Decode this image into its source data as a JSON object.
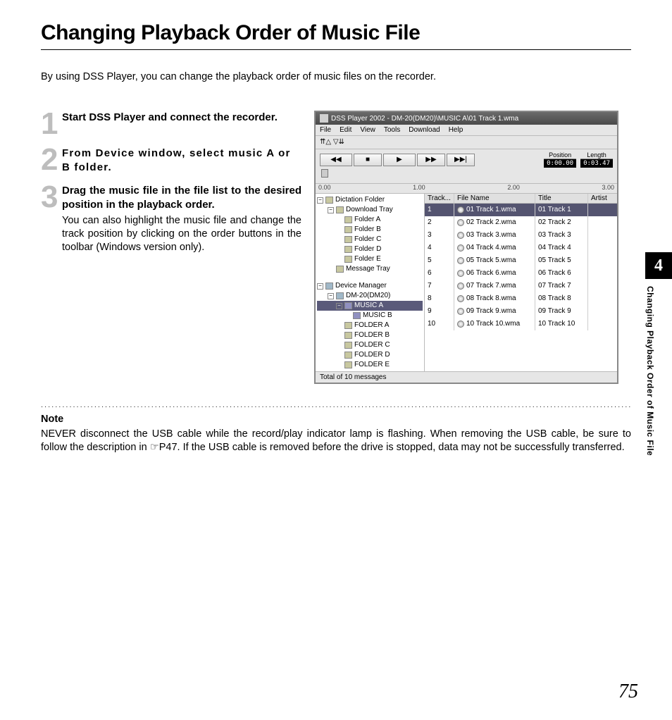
{
  "title": "Changing Playback Order of Music File",
  "intro": "By using DSS Player, you can change the playback order of music files on the recorder.",
  "steps": [
    {
      "num": "1",
      "head": "Start DSS Player and connect the recorder.",
      "text": ""
    },
    {
      "num": "2",
      "head": "From Device window, select music A or B folder.",
      "text": ""
    },
    {
      "num": "3",
      "head": "Drag the music file in the file list to the desired position in the playback order.",
      "text": "You can also highlight the music file and change the track position by clicking on the order buttons in the toolbar (Windows version only)."
    }
  ],
  "note_head": "Note",
  "note_text": "NEVER disconnect the USB cable while the record/play indicator lamp is flashing. When removing the USB cable, be sure to follow the description in ☞P47. If the USB cable is removed before the drive is stopped, data may not be successfully transferred.",
  "screenshot": {
    "title": "DSS Player 2002 - DM-20(DM20)\\MUSIC A\\01 Track 1.wma",
    "menus": [
      "File",
      "Edit",
      "View",
      "Tools",
      "Download",
      "Help"
    ],
    "order_icons": "⇈△ ▽⇊",
    "play_icons": {
      "rew": "◀◀",
      "stop": "■",
      "play": "▶",
      "ff": "▶▶",
      "next": "▶▶|"
    },
    "position_label": "Position",
    "length_label": "Length",
    "position_val": "0:00.00",
    "length_val": "0:03.47",
    "ruler": [
      "0.00",
      "1.00",
      "2.00",
      "3.00"
    ],
    "tree": {
      "dict_root": "Dictation Folder",
      "download": "Download Tray",
      "folders": [
        "Folder A",
        "Folder B",
        "Folder C",
        "Folder D",
        "Folder E"
      ],
      "msg_tray": "Message Tray",
      "dev_root": "Device Manager",
      "device": "DM-20(DM20)",
      "music_a": "MUSIC A",
      "music_b": "MUSIC B",
      "dev_folders": [
        "FOLDER A",
        "FOLDER B",
        "FOLDER C",
        "FOLDER D",
        "FOLDER E"
      ]
    },
    "columns": {
      "track": "Track...",
      "file": "File Name",
      "title": "Title",
      "artist": "Artist"
    },
    "rows": [
      {
        "n": "1",
        "file": "01 Track 1.wma",
        "title": "01 Track 1"
      },
      {
        "n": "2",
        "file": "02 Track 2.wma",
        "title": "02 Track 2"
      },
      {
        "n": "3",
        "file": "03 Track 3.wma",
        "title": "03 Track 3"
      },
      {
        "n": "4",
        "file": "04 Track 4.wma",
        "title": "04 Track 4"
      },
      {
        "n": "5",
        "file": "05 Track 5.wma",
        "title": "05 Track 5"
      },
      {
        "n": "6",
        "file": "06 Track 6.wma",
        "title": "06 Track 6"
      },
      {
        "n": "7",
        "file": "07 Track 7.wma",
        "title": "07 Track 7"
      },
      {
        "n": "8",
        "file": "08 Track 8.wma",
        "title": "08 Track 8"
      },
      {
        "n": "9",
        "file": "09 Track 9.wma",
        "title": "09 Track 9"
      },
      {
        "n": "10",
        "file": "10 Track 10.wma",
        "title": "10 Track 10"
      }
    ],
    "status": "Total of 10 messages"
  },
  "chapter_num": "4",
  "side_text": "Changing Playback Order of Music File",
  "page_number": "75"
}
